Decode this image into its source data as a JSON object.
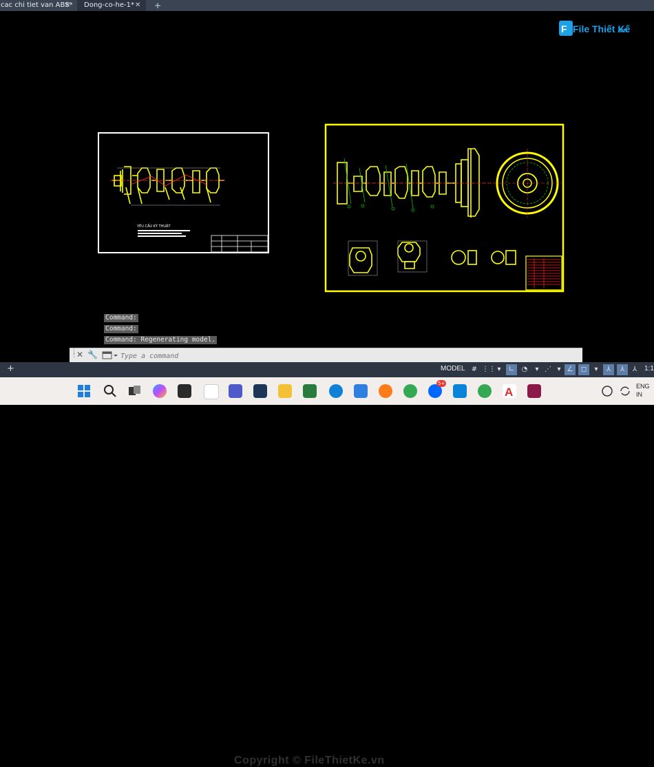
{
  "tabs": [
    {
      "label": "cac chi tiet van ABS*"
    },
    {
      "label": "Dong-co-he-1*"
    }
  ],
  "logo": {
    "text": "File Thiết Kế",
    "suffix": ".vn"
  },
  "drawing1": {
    "notes_title": "YÊU CẦU KỸ THUẬT"
  },
  "command_history": [
    "Command:",
    "Command:",
    "Command: Regenerating model."
  ],
  "command_line": {
    "placeholder": "Type a command"
  },
  "status": {
    "model_label": "MODEL",
    "scale": "1:1"
  },
  "tray": {
    "lang": "ENG",
    "region": "IN"
  },
  "taskbar": {
    "zalo_badge": "5+"
  },
  "watermark": "Copyright © FileThietKe.vn",
  "colors": {
    "drawing_line": "#ffff00",
    "frame1": "#ffffff",
    "frame2": "#ffff00",
    "dim": "#00c000",
    "center": "#ff3030"
  }
}
